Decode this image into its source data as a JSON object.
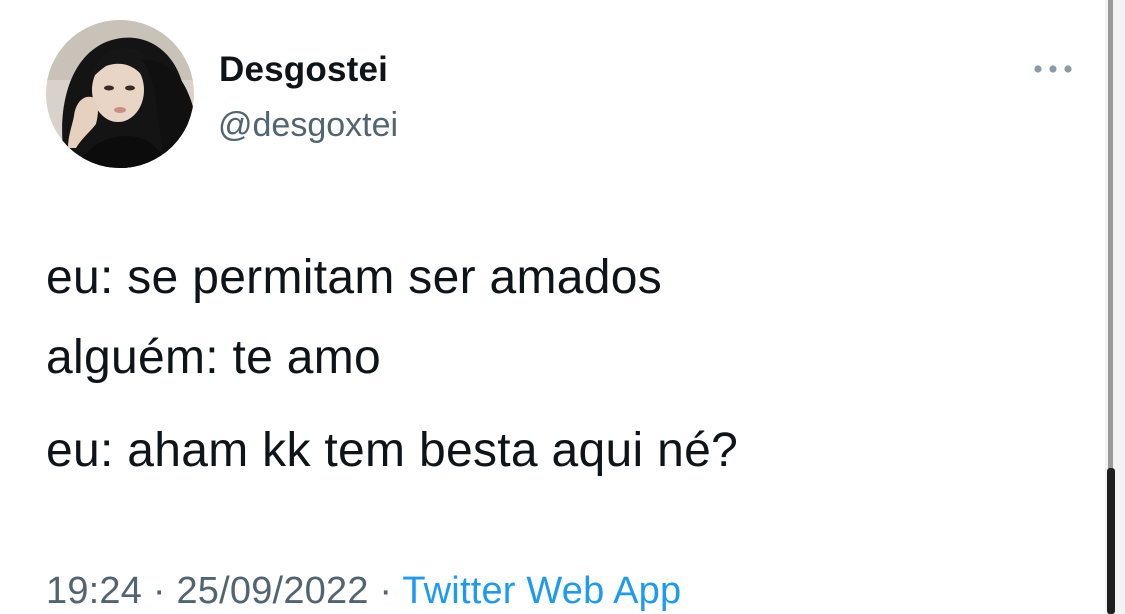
{
  "author": {
    "name": "Desgostei",
    "handle": "@desgoxtei",
    "avatar_icon": "profile-photo"
  },
  "more_icon": "more-dots-icon",
  "tweet": {
    "lines": [
      "eu: se permitam ser amados",
      "alguém: te amo",
      "eu: aham kk tem besta aqui né?"
    ]
  },
  "meta": {
    "time": "19:24",
    "date": "25/09/2022",
    "separator": " · ",
    "source": "Twitter Web App"
  },
  "colors": {
    "text": "#0f1419",
    "secondary": "#536471",
    "link": "#1d9bf0",
    "background": "#ffffff"
  }
}
